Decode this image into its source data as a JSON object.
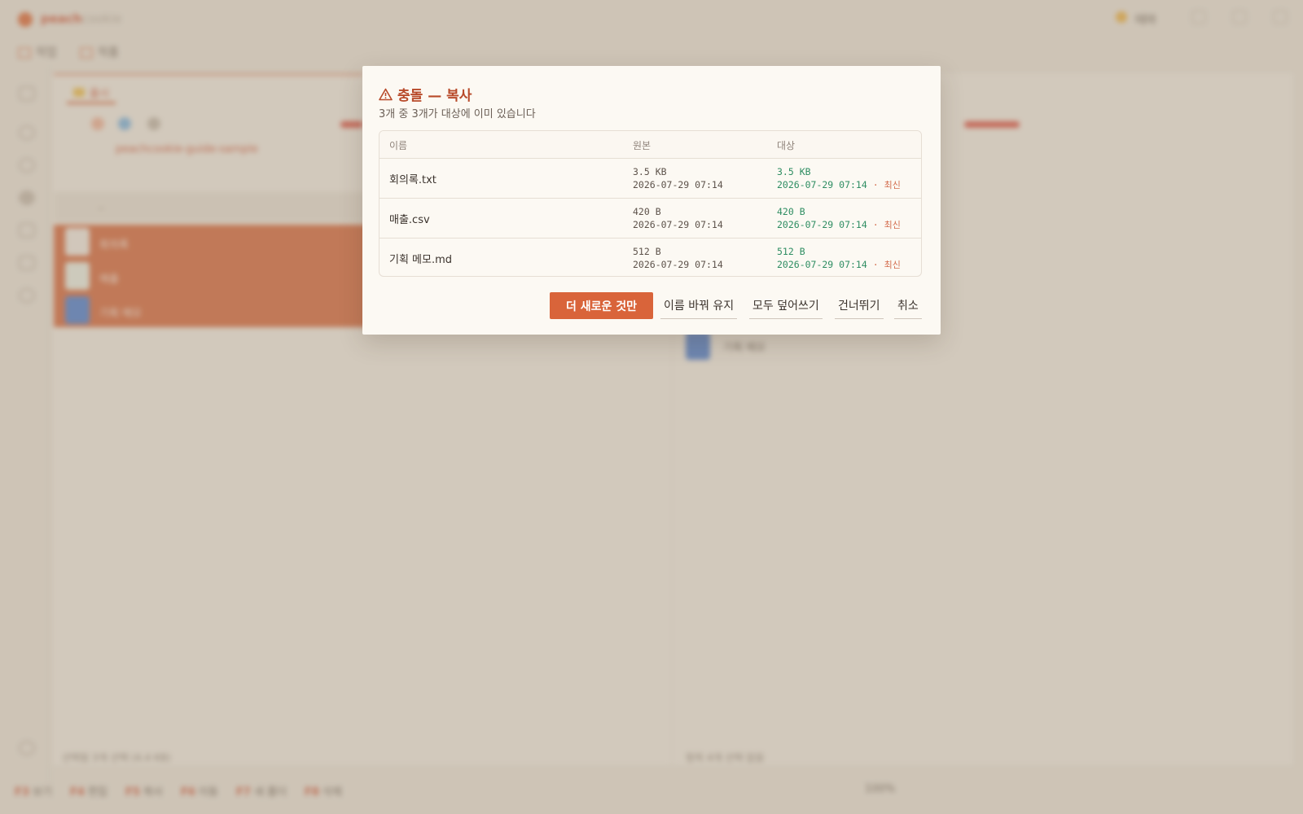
{
  "app": {
    "title_strong": "peach",
    "title_light": "cookie",
    "theme_label": "테마",
    "tabs": [
      "작업",
      "작품"
    ],
    "left_pane": {
      "tab_label": "출시",
      "path": "peachcookie-guide-sample",
      "up_label": "..",
      "files": [
        "회의록",
        "매출",
        "기획 메모"
      ],
      "status": "선택됨 3개 선택 (4.4 KB)"
    },
    "right_pane": {
      "files": [
        "기획 메모"
      ],
      "status": "항목 4개 선택 없음"
    },
    "statusbar": {
      "keys": [
        {
          "key": "F3",
          "label": "보기"
        },
        {
          "key": "F4",
          "label": "편집"
        },
        {
          "key": "F5",
          "label": "복사"
        },
        {
          "key": "F6",
          "label": "이동"
        },
        {
          "key": "F7",
          "label": "새 폴더"
        },
        {
          "key": "F8",
          "label": "삭제"
        }
      ],
      "zoom": "100%"
    }
  },
  "dialog": {
    "title": "충돌 — 복사",
    "subtitle": "3개 중 3개가 대상에 이미 있습니다",
    "columns": {
      "name": "이름",
      "source": "원본",
      "target": "대상"
    },
    "rows": [
      {
        "name": "회의록.txt",
        "src_size": "3.5 KB",
        "src_date": "2026-07-29 07:14",
        "dst_size": "3.5 KB",
        "dst_date": "2026-07-29 07:14",
        "dst_tag": "최신"
      },
      {
        "name": "매출.csv",
        "src_size": "420 B",
        "src_date": "2026-07-29 07:14",
        "dst_size": "420 B",
        "dst_date": "2026-07-29 07:14",
        "dst_tag": "최신"
      },
      {
        "name": "기획 메모.md",
        "src_size": "512 B",
        "src_date": "2026-07-29 07:14",
        "dst_size": "512 B",
        "dst_date": "2026-07-29 07:14",
        "dst_tag": "최신"
      }
    ],
    "buttons": {
      "newer_only": "더 새로운 것만",
      "keep_rename": "이름 바꿔 유지",
      "overwrite_all": "모두 덮어쓰기",
      "skip": "건너뛰기",
      "cancel": "취소"
    },
    "separator": "·"
  },
  "icons": {
    "warning": "warning-triangle-icon"
  },
  "colors": {
    "accent": "#d9643a",
    "title": "#b84a2a",
    "target_text": "#2e8d62",
    "newer_tag": "#d46e4f"
  }
}
